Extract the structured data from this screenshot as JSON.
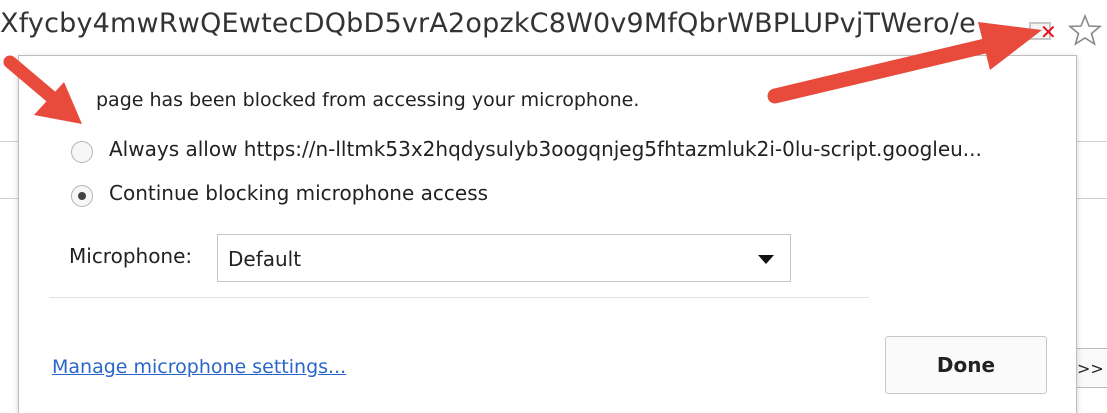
{
  "address_bar": {
    "url_text": "Xfycby4mwRwQEwtecDQbD5vrA2opzkC8W0v9MfQbrWBPLUPvjTWero/e"
  },
  "icons": {
    "camera_blocked": "camera-blocked-icon",
    "bookmark_star": "star-icon"
  },
  "bubble": {
    "message": "page has been blocked from accessing your microphone.",
    "options": [
      {
        "label": "Always allow https://n-lltmk53x2hqdysulyb3oogqnjeg5fhtazmluk2i-0lu-script.googleu...",
        "selected": false
      },
      {
        "label": "Continue blocking microphone access",
        "selected": true
      }
    ],
    "microphone_label": "Microphone:",
    "microphone_value": "Default",
    "manage_link": "Manage microphone settings...",
    "done_label": "Done"
  },
  "page": {
    "more_button": ">>"
  },
  "colors": {
    "annotation_arrow": "#e84a3c",
    "link": "#2a66c9",
    "blocked_badge": "#e3101a"
  }
}
